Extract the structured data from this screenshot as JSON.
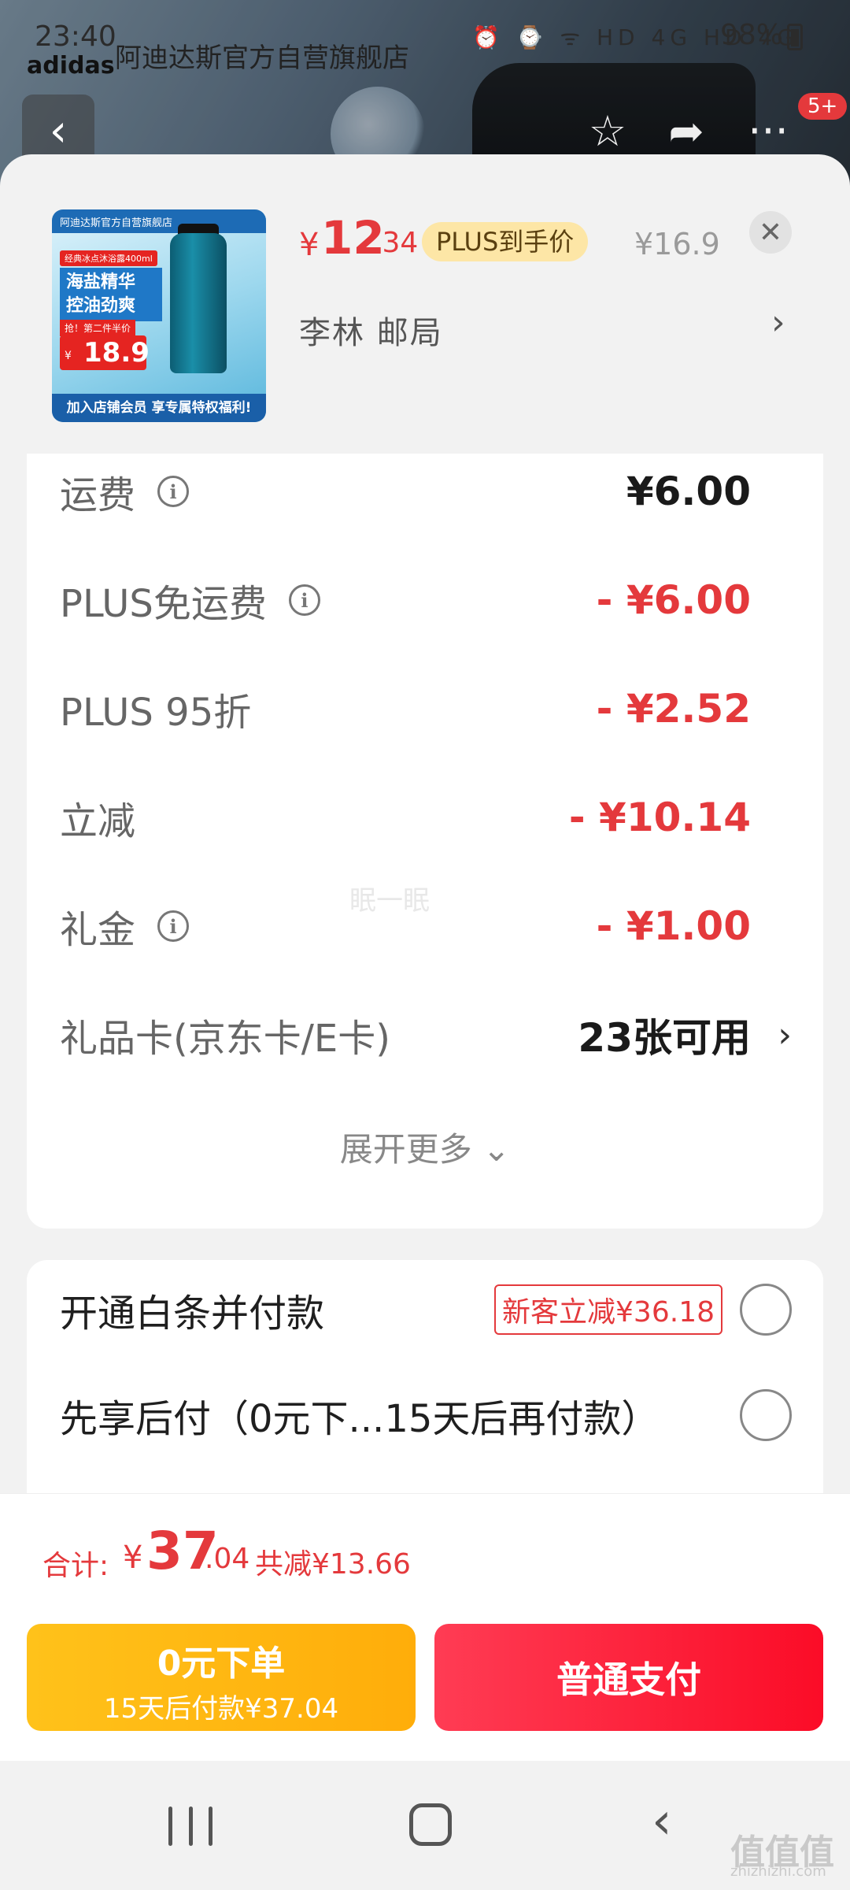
{
  "status_bar": {
    "time": "23:40",
    "icons": "⏰ ⌚ ᯤ HD 4G HD 4G",
    "battery": "98%"
  },
  "store": {
    "logo": "adidas",
    "name": "阿迪达斯官方自营旗舰店",
    "notification_badge": "5+"
  },
  "product": {
    "image": {
      "top_text": "阿迪达斯官方自营旗舰店",
      "tag": "经典冰点沐浴露400ml",
      "title": "海盐精华 控油劲爽",
      "offer": "抢！第二件半价",
      "price_currency": "¥",
      "price": "18.9",
      "bottom_banner": "加入店铺会员 享专属特权福利!"
    },
    "price_currency": "¥",
    "price_int": "12",
    "price_dec": ".34",
    "plus_label": "PLUS到手价",
    "original_price": "¥16.9",
    "address": "李林  邮局"
  },
  "fees": [
    {
      "label": "运费",
      "info": true,
      "value": "¥6.00",
      "red": false
    },
    {
      "label": "PLUS免运费",
      "info": true,
      "value": "- ¥6.00",
      "red": true
    },
    {
      "label": "PLUS 95折",
      "info": false,
      "value": "- ¥2.52",
      "red": true
    },
    {
      "label": "立减",
      "info": false,
      "value": "- ¥10.14",
      "red": true
    },
    {
      "label": "礼金",
      "info": true,
      "value": "- ¥1.00",
      "red": true
    },
    {
      "label": "礼品卡(京东卡/E卡)",
      "info": false,
      "value": "23张可用",
      "red": false
    }
  ],
  "expand_label": "展开更多",
  "watermark": "眠一眠",
  "pay_options": [
    {
      "label": "开通白条并付款",
      "promo": "新客立减¥36.18"
    },
    {
      "label": "先享后付（0元下...15天后再付款）",
      "promo": ""
    }
  ],
  "total": {
    "label": "合计:",
    "currency": "¥",
    "int": "37",
    "dec": ".04",
    "savings": "共减¥13.66"
  },
  "buttons": {
    "zero_line1": "0元下单",
    "zero_line2": "15天后付款¥37.04",
    "pay": "普通支付"
  },
  "site_watermark": {
    "logo": "值值值",
    "domain": "zhizhizhi.com"
  }
}
